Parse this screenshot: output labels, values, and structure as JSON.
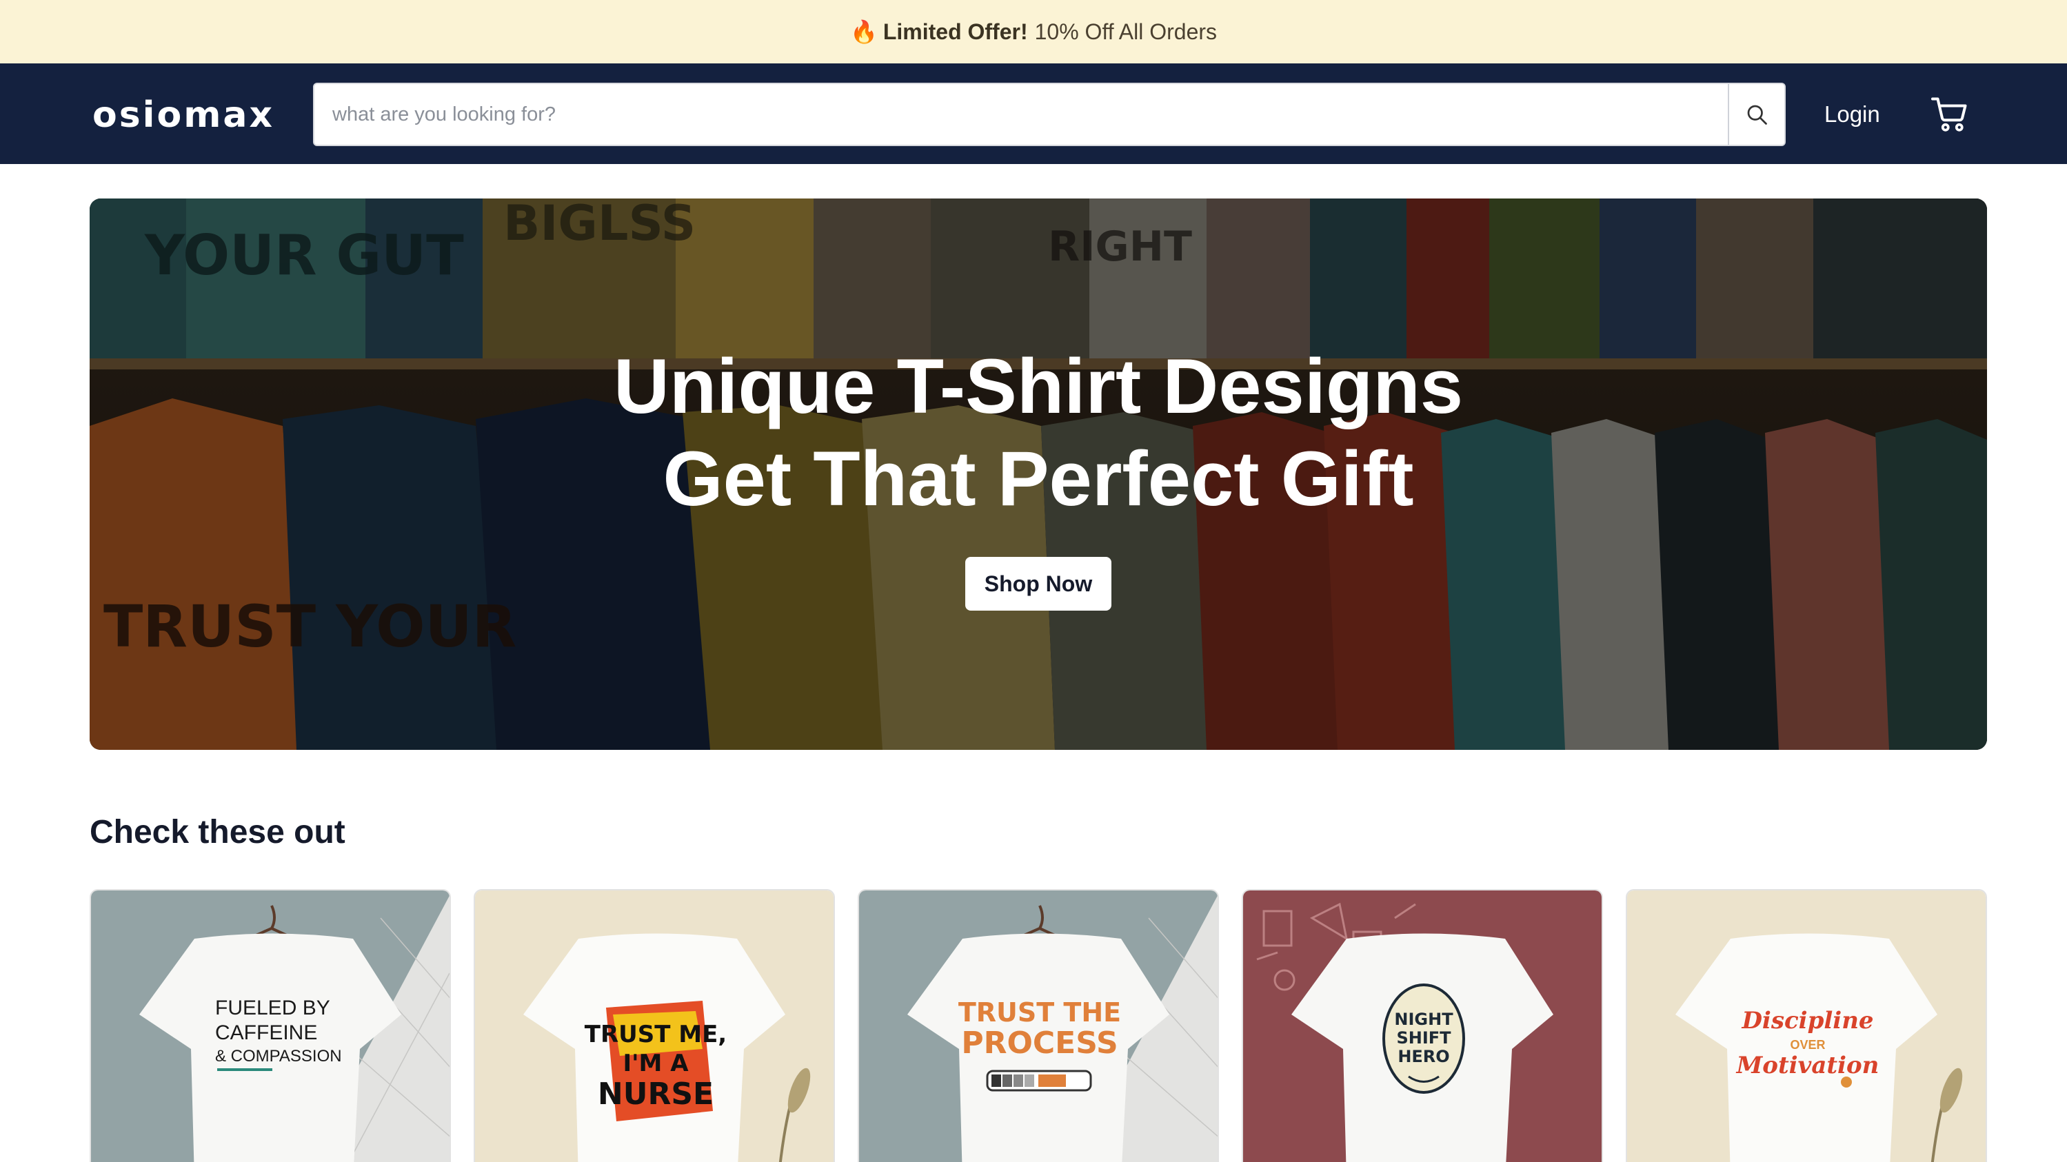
{
  "promo": {
    "icon": "fire-icon",
    "highlight": "Limited Offer!",
    "text": "10% Off All Orders"
  },
  "header": {
    "logo": "osiomax",
    "search_placeholder": "what are you looking for?",
    "search_icon": "search-icon",
    "login_label": "Login",
    "cart_icon": "cart-icon"
  },
  "hero": {
    "title_line1": "Unique T-Shirt Designs",
    "title_line2": "Get That Perfect Gift",
    "cta_label": "Shop Now",
    "bg_shirt_text_1": "YOUR GUT",
    "bg_shirt_text_2": "TRUST YOUR",
    "bg_shirt_text_3": "RIGHT",
    "bg_shirt_text_4": "BIGLSS"
  },
  "section": {
    "title": "Check these out"
  },
  "products": [
    {
      "design_lines": [
        "FUELED BY",
        "CAFFEINE",
        "& COMPASSION"
      ],
      "bg": "#93a3a5",
      "accent": "#1a1a1a"
    },
    {
      "design_lines": [
        "TRUST ME,",
        "I'M A",
        "NURSE"
      ],
      "bg": "#ece3cc",
      "accent": "#111111"
    },
    {
      "design_lines": [
        "TRUST THE",
        "PROCESS"
      ],
      "bg": "#93a3a5",
      "accent": "#e0803a"
    },
    {
      "design_lines": [
        "NIGHT",
        "SHIFT",
        "HERO"
      ],
      "bg": "#8d4a4e",
      "accent": "#1d2a36"
    },
    {
      "design_lines": [
        "Discipline",
        "OVER",
        "Motivation"
      ],
      "bg": "#ece3cc",
      "accent": "#d9432b"
    }
  ],
  "colors": {
    "promo_bg": "#fbf3d5",
    "header_bg": "#14213f",
    "text_dark": "#151a2b"
  }
}
